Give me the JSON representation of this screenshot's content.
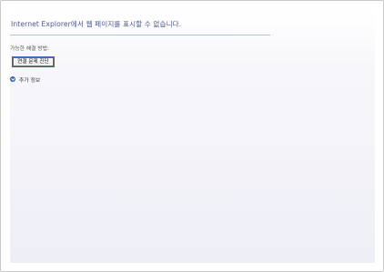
{
  "error_page": {
    "title": "Internet Explorer에서 웹 페이지를 표시할 수 없습니다.",
    "section_label": "가능한 해결 방법:",
    "refresh_button_label": "연결 문제 진단",
    "more_info_label": "추가 정보",
    "more_info_icon": "chevron-down-icon"
  },
  "colors": {
    "title": "#4a5a8a",
    "accent": "#3c5fa8",
    "rule": "#b9c0d4"
  }
}
